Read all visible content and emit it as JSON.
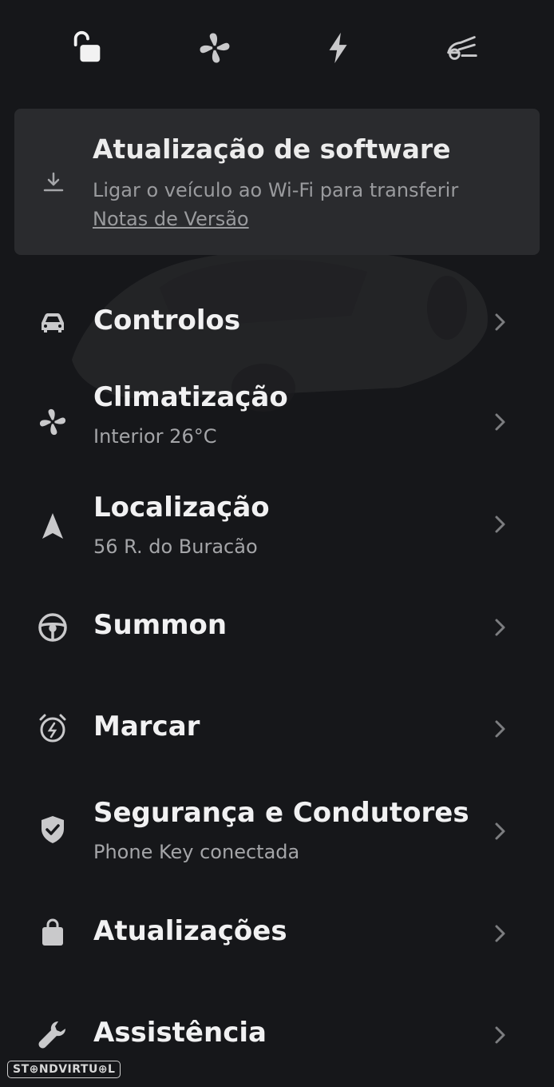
{
  "topbar": {
    "icons": [
      "lock-open-icon",
      "fan-icon",
      "bolt-icon",
      "trunk-icon"
    ]
  },
  "update_card": {
    "icon": "download-icon",
    "title": "Atualização de software",
    "subtitle": "Ligar o veículo ao Wi-Fi para transferir",
    "link": "Notas de Versão"
  },
  "menu": [
    {
      "icon": "car-icon",
      "label": "Controlos",
      "sub": ""
    },
    {
      "icon": "fan-icon",
      "label": "Climatização",
      "sub": "Interior 26°C"
    },
    {
      "icon": "navigation-arrow-icon",
      "label": "Localização",
      "sub": "56 R. do Buracão"
    },
    {
      "icon": "steering-wheel-icon",
      "label": "Summon",
      "sub": ""
    },
    {
      "icon": "alarm-clock-icon",
      "label": "Marcar",
      "sub": ""
    },
    {
      "icon": "shield-check-icon",
      "label": "Segurança e Condutores",
      "sub": "Phone Key conectada"
    },
    {
      "icon": "shopping-bag-icon",
      "label": "Atualizações",
      "sub": ""
    },
    {
      "icon": "wrench-icon",
      "label": "Assistência",
      "sub": ""
    }
  ],
  "watermark": "ST⊕NDVIRTU⊕L",
  "colors": {
    "background": "#16171a",
    "card": "#2a2b2e",
    "text": "#f1f1f2",
    "muted": "#a4a5a8"
  }
}
